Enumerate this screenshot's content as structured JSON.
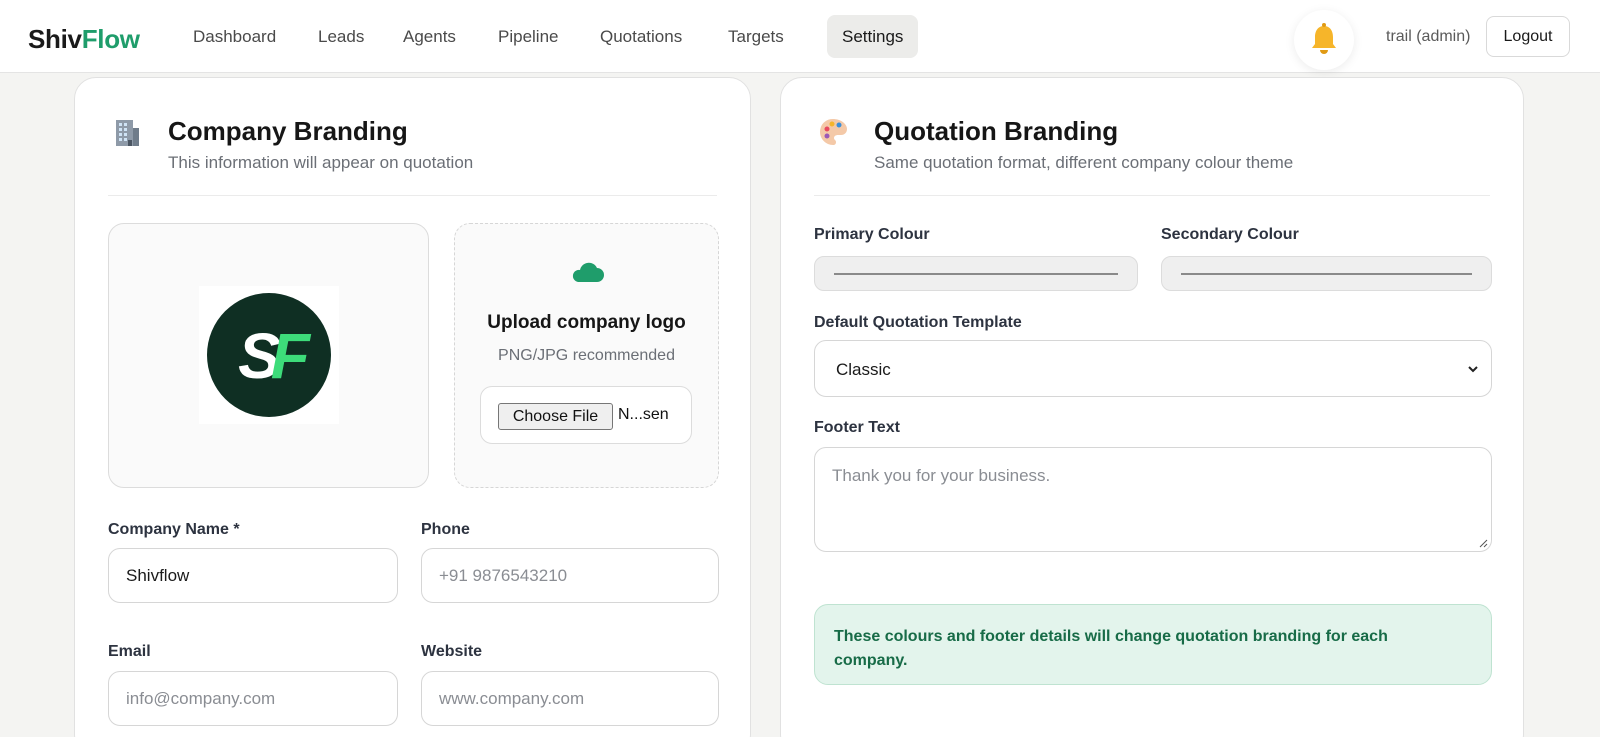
{
  "app": {
    "brand_part1": "Shiv",
    "brand_part2": "Flow"
  },
  "nav": {
    "items": [
      {
        "label": "Dashboard"
      },
      {
        "label": "Leads"
      },
      {
        "label": "Agents"
      },
      {
        "label": "Pipeline"
      },
      {
        "label": "Quotations"
      },
      {
        "label": "Targets"
      },
      {
        "label": "Settings",
        "active": true
      }
    ],
    "user_label": "trail (admin)",
    "logout_label": "Logout",
    "bell_icon": "bell-icon"
  },
  "company_branding": {
    "icon": "office-building-icon",
    "title": "Company Branding",
    "subtitle": "This information will appear on quotation",
    "logo_text": "SF",
    "upload": {
      "icon": "cloud-icon",
      "title": "Upload company logo",
      "hint": "PNG/JPG recommended",
      "button_label": "Choose File",
      "file_name": "N...sen"
    },
    "fields": {
      "company_name_label": "Company Name *",
      "company_name_value": "Shivflow",
      "phone_label": "Phone",
      "phone_placeholder": "+91 9876543210",
      "email_label": "Email",
      "email_placeholder": "info@company.com",
      "website_label": "Website",
      "website_placeholder": "www.company.com"
    }
  },
  "quotation_branding": {
    "icon": "palette-icon",
    "title": "Quotation Branding",
    "subtitle": "Same quotation format, different company colour theme",
    "primary_colour_label": "Primary Colour",
    "secondary_colour_label": "Secondary Colour",
    "template_label": "Default Quotation Template",
    "template_value": "Classic",
    "footer_label": "Footer Text",
    "footer_placeholder": "Thank you for your business.",
    "info_text": "These colours and footer details will change quotation branding for each company."
  },
  "colors": {
    "brand_green": "#1f9d6b",
    "logo_dark": "#0f2f23",
    "logo_light_green": "#3ddc7a",
    "info_bg": "#e3f4ec",
    "info_text": "#176b47"
  }
}
